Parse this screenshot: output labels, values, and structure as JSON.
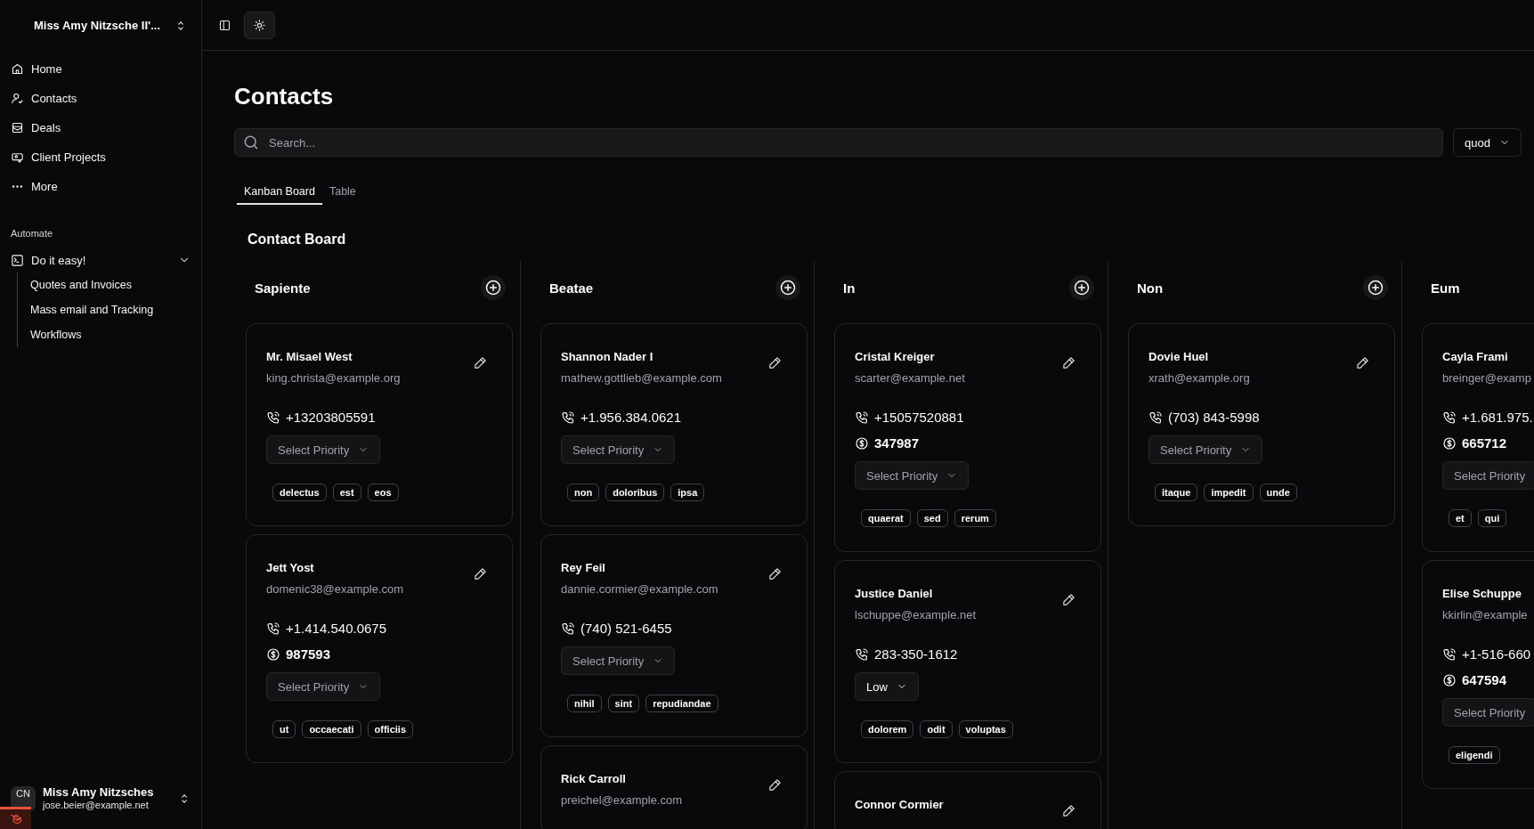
{
  "workspace": {
    "name": "Miss Amy Nitzsche II'..."
  },
  "nav": [
    {
      "label": "Home"
    },
    {
      "label": "Contacts"
    },
    {
      "label": "Deals"
    },
    {
      "label": "Client Projects"
    },
    {
      "label": "More"
    }
  ],
  "automate": {
    "heading": "Automate",
    "group": {
      "label": "Do it easy!",
      "expanded": true,
      "children": [
        {
          "label": "Quotes and Invoices"
        },
        {
          "label": "Mass email and Tracking"
        },
        {
          "label": "Workflows"
        }
      ]
    }
  },
  "user": {
    "initials": "CN",
    "name": "Miss Amy Nitzsches",
    "email": "jose.beier@example.net"
  },
  "page": {
    "title": "Contacts",
    "search": {
      "placeholder": "Search..."
    },
    "filter": "quod"
  },
  "tabs": [
    {
      "label": "Kanban Board",
      "selected": true
    },
    {
      "label": "Table",
      "selected": false
    }
  ],
  "board": {
    "title": "Contact Board",
    "columns": [
      {
        "title": "Sapiente",
        "cards": [
          {
            "name": "Mr. Misael West",
            "email": "king.christa@example.org",
            "phone": "+13203805591",
            "priority": {
              "placeholder": "Select Priority"
            },
            "tags": [
              "delectus",
              "est",
              "eos"
            ]
          },
          {
            "name": "Jett Yost",
            "email": "domenic38@example.com",
            "phone": "+1.414.540.0675",
            "amount": "987593",
            "priority": {
              "placeholder": "Select Priority"
            },
            "tags": [
              "ut",
              "occaecati",
              "officiis"
            ]
          }
        ]
      },
      {
        "title": "Beatae",
        "cards": [
          {
            "name": "Shannon Nader I",
            "email": "mathew.gottlieb@example.com",
            "phone": "+1.956.384.0621",
            "priority": {
              "placeholder": "Select Priority"
            },
            "tags": [
              "non",
              "doloribus",
              "ipsa"
            ]
          },
          {
            "name": "Rey Feil",
            "email": "dannie.cormier@example.com",
            "phone": "(740) 521-6455",
            "priority": {
              "placeholder": "Select Priority"
            },
            "tags": [
              "nihil",
              "sint",
              "repudiandae"
            ]
          },
          {
            "name": "Rick Carroll",
            "email": "preichel@example.com"
          }
        ]
      },
      {
        "title": "In",
        "cards": [
          {
            "name": "Cristal Kreiger",
            "email": "scarter@example.net",
            "phone": "+15057520881",
            "amount": "347987",
            "priority": {
              "placeholder": "Select Priority"
            },
            "tags": [
              "quaerat",
              "sed",
              "rerum"
            ]
          },
          {
            "name": "Justice Daniel",
            "email": "lschuppe@example.net",
            "phone": "283-350-1612",
            "priority": {
              "value": "Low"
            },
            "tags": [
              "dolorem",
              "odit",
              "voluptas"
            ]
          },
          {
            "name": "Connor Cormier"
          }
        ]
      },
      {
        "title": "Non",
        "cards": [
          {
            "name": "Dovie Huel",
            "email": "xrath@example.org",
            "phone": "(703) 843-5998",
            "priority": {
              "placeholder": "Select Priority"
            },
            "tags": [
              "itaque",
              "impedit",
              "unde"
            ]
          }
        ]
      },
      {
        "title": "Eum",
        "cut": true,
        "cards": [
          {
            "name": "Cayla Frami",
            "email": "breinger@examp",
            "phone": "+1.681.975.",
            "amount": "665712",
            "priority": {
              "placeholder": "Select Priority"
            },
            "tags": [
              "et",
              "qui"
            ]
          },
          {
            "name": "Elise Schuppe",
            "email": "kkirlin@example",
            "phone": "+1-516-660",
            "amount": "647594",
            "priority": {
              "placeholder": "Select Priority"
            },
            "tags": [
              "eligendi"
            ]
          }
        ]
      }
    ]
  }
}
